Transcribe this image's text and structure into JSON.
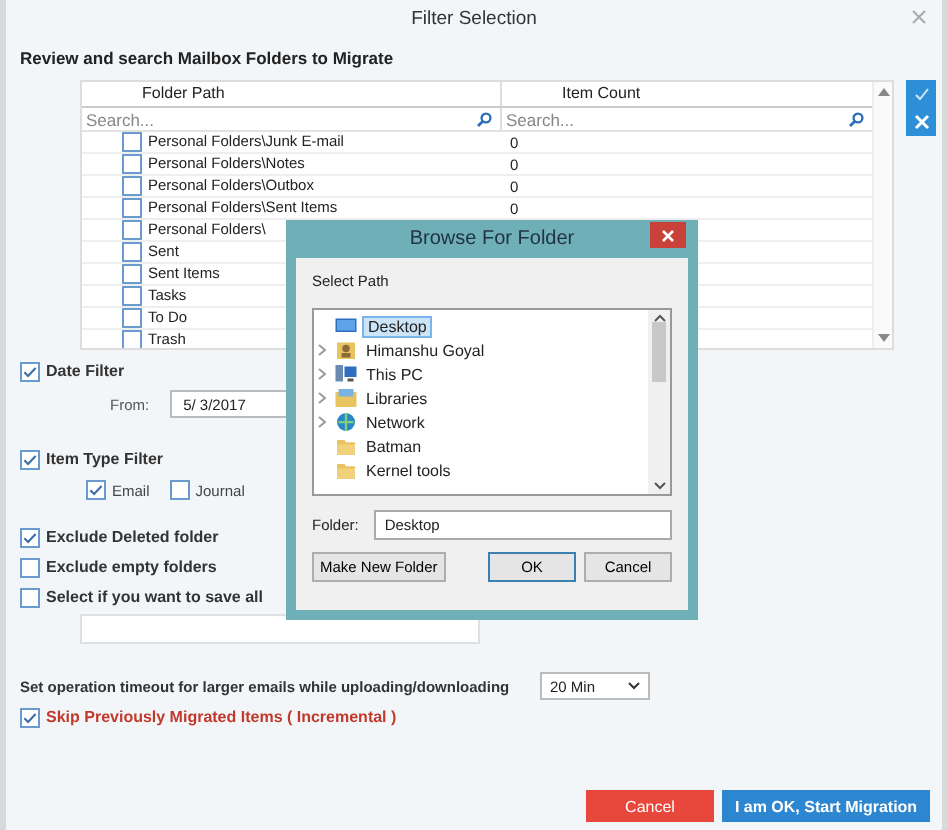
{
  "window": {
    "title": "Filter Selection"
  },
  "heading": "Review and search Mailbox Folders to Migrate",
  "folder_grid": {
    "columns": [
      "Folder Path",
      "Item Count"
    ],
    "search_placeholders": [
      "Search...",
      "Search..."
    ],
    "rows": [
      {
        "path": "Personal Folders\\Junk E-mail",
        "count": "0",
        "checked": false
      },
      {
        "path": "Personal Folders\\Notes",
        "count": "0",
        "checked": false
      },
      {
        "path": "Personal Folders\\Outbox",
        "count": "0",
        "checked": false
      },
      {
        "path": "Personal Folders\\Sent Items",
        "count": "0",
        "checked": false
      },
      {
        "path": "Personal Folders\\",
        "checked": false
      },
      {
        "path": "Sent",
        "checked": false
      },
      {
        "path": "Sent Items",
        "checked": false
      },
      {
        "path": "Tasks",
        "checked": false
      },
      {
        "path": "To Do",
        "checked": false
      },
      {
        "path": "Trash",
        "checked": false
      }
    ]
  },
  "date_filter": {
    "label": "Date Filter",
    "checked": true,
    "from_label": "From:",
    "from_value": "5/ 3/2017"
  },
  "item_type_filter": {
    "label": "Item Type Filter",
    "checked": true,
    "types": [
      {
        "label": "Email",
        "checked": true
      },
      {
        "label": "Journal",
        "checked": false
      }
    ]
  },
  "options": [
    {
      "label": "Exclude Deleted folder",
      "checked": true
    },
    {
      "label": "Exclude empty folders",
      "checked": false
    },
    {
      "label": "Select if you want to save all",
      "checked": false
    }
  ],
  "timeout": {
    "label": "Set operation timeout for larger emails while uploading/downloading",
    "value": "20 Min"
  },
  "incremental": {
    "label": "Skip Previously Migrated Items ( Incremental )",
    "checked": true
  },
  "buttons": [
    {
      "label": "Cancel",
      "kind": "cancel"
    },
    {
      "label": "I am OK, Start Migration",
      "kind": "primary"
    }
  ],
  "browse_dialog": {
    "title": "Browse For Folder",
    "prompt": "Select Path",
    "tree": [
      {
        "label": "Desktop",
        "kind": "desktop",
        "selected": true,
        "expandable": false
      },
      {
        "label": "Himanshu Goyal",
        "kind": "user",
        "selected": false,
        "expandable": true
      },
      {
        "label": "This PC",
        "kind": "pc",
        "selected": false,
        "expandable": true
      },
      {
        "label": "Libraries",
        "kind": "libraries",
        "selected": false,
        "expandable": true
      },
      {
        "label": "Network",
        "kind": "network",
        "selected": false,
        "expandable": true
      },
      {
        "label": "Batman",
        "kind": "folder",
        "selected": false,
        "expandable": false
      },
      {
        "label": "Kernel tools",
        "kind": "folder",
        "selected": false,
        "expandable": false
      }
    ],
    "folder_label": "Folder:",
    "folder_value": "Desktop",
    "buttons": [
      "Make New Folder",
      "OK",
      "Cancel"
    ]
  }
}
